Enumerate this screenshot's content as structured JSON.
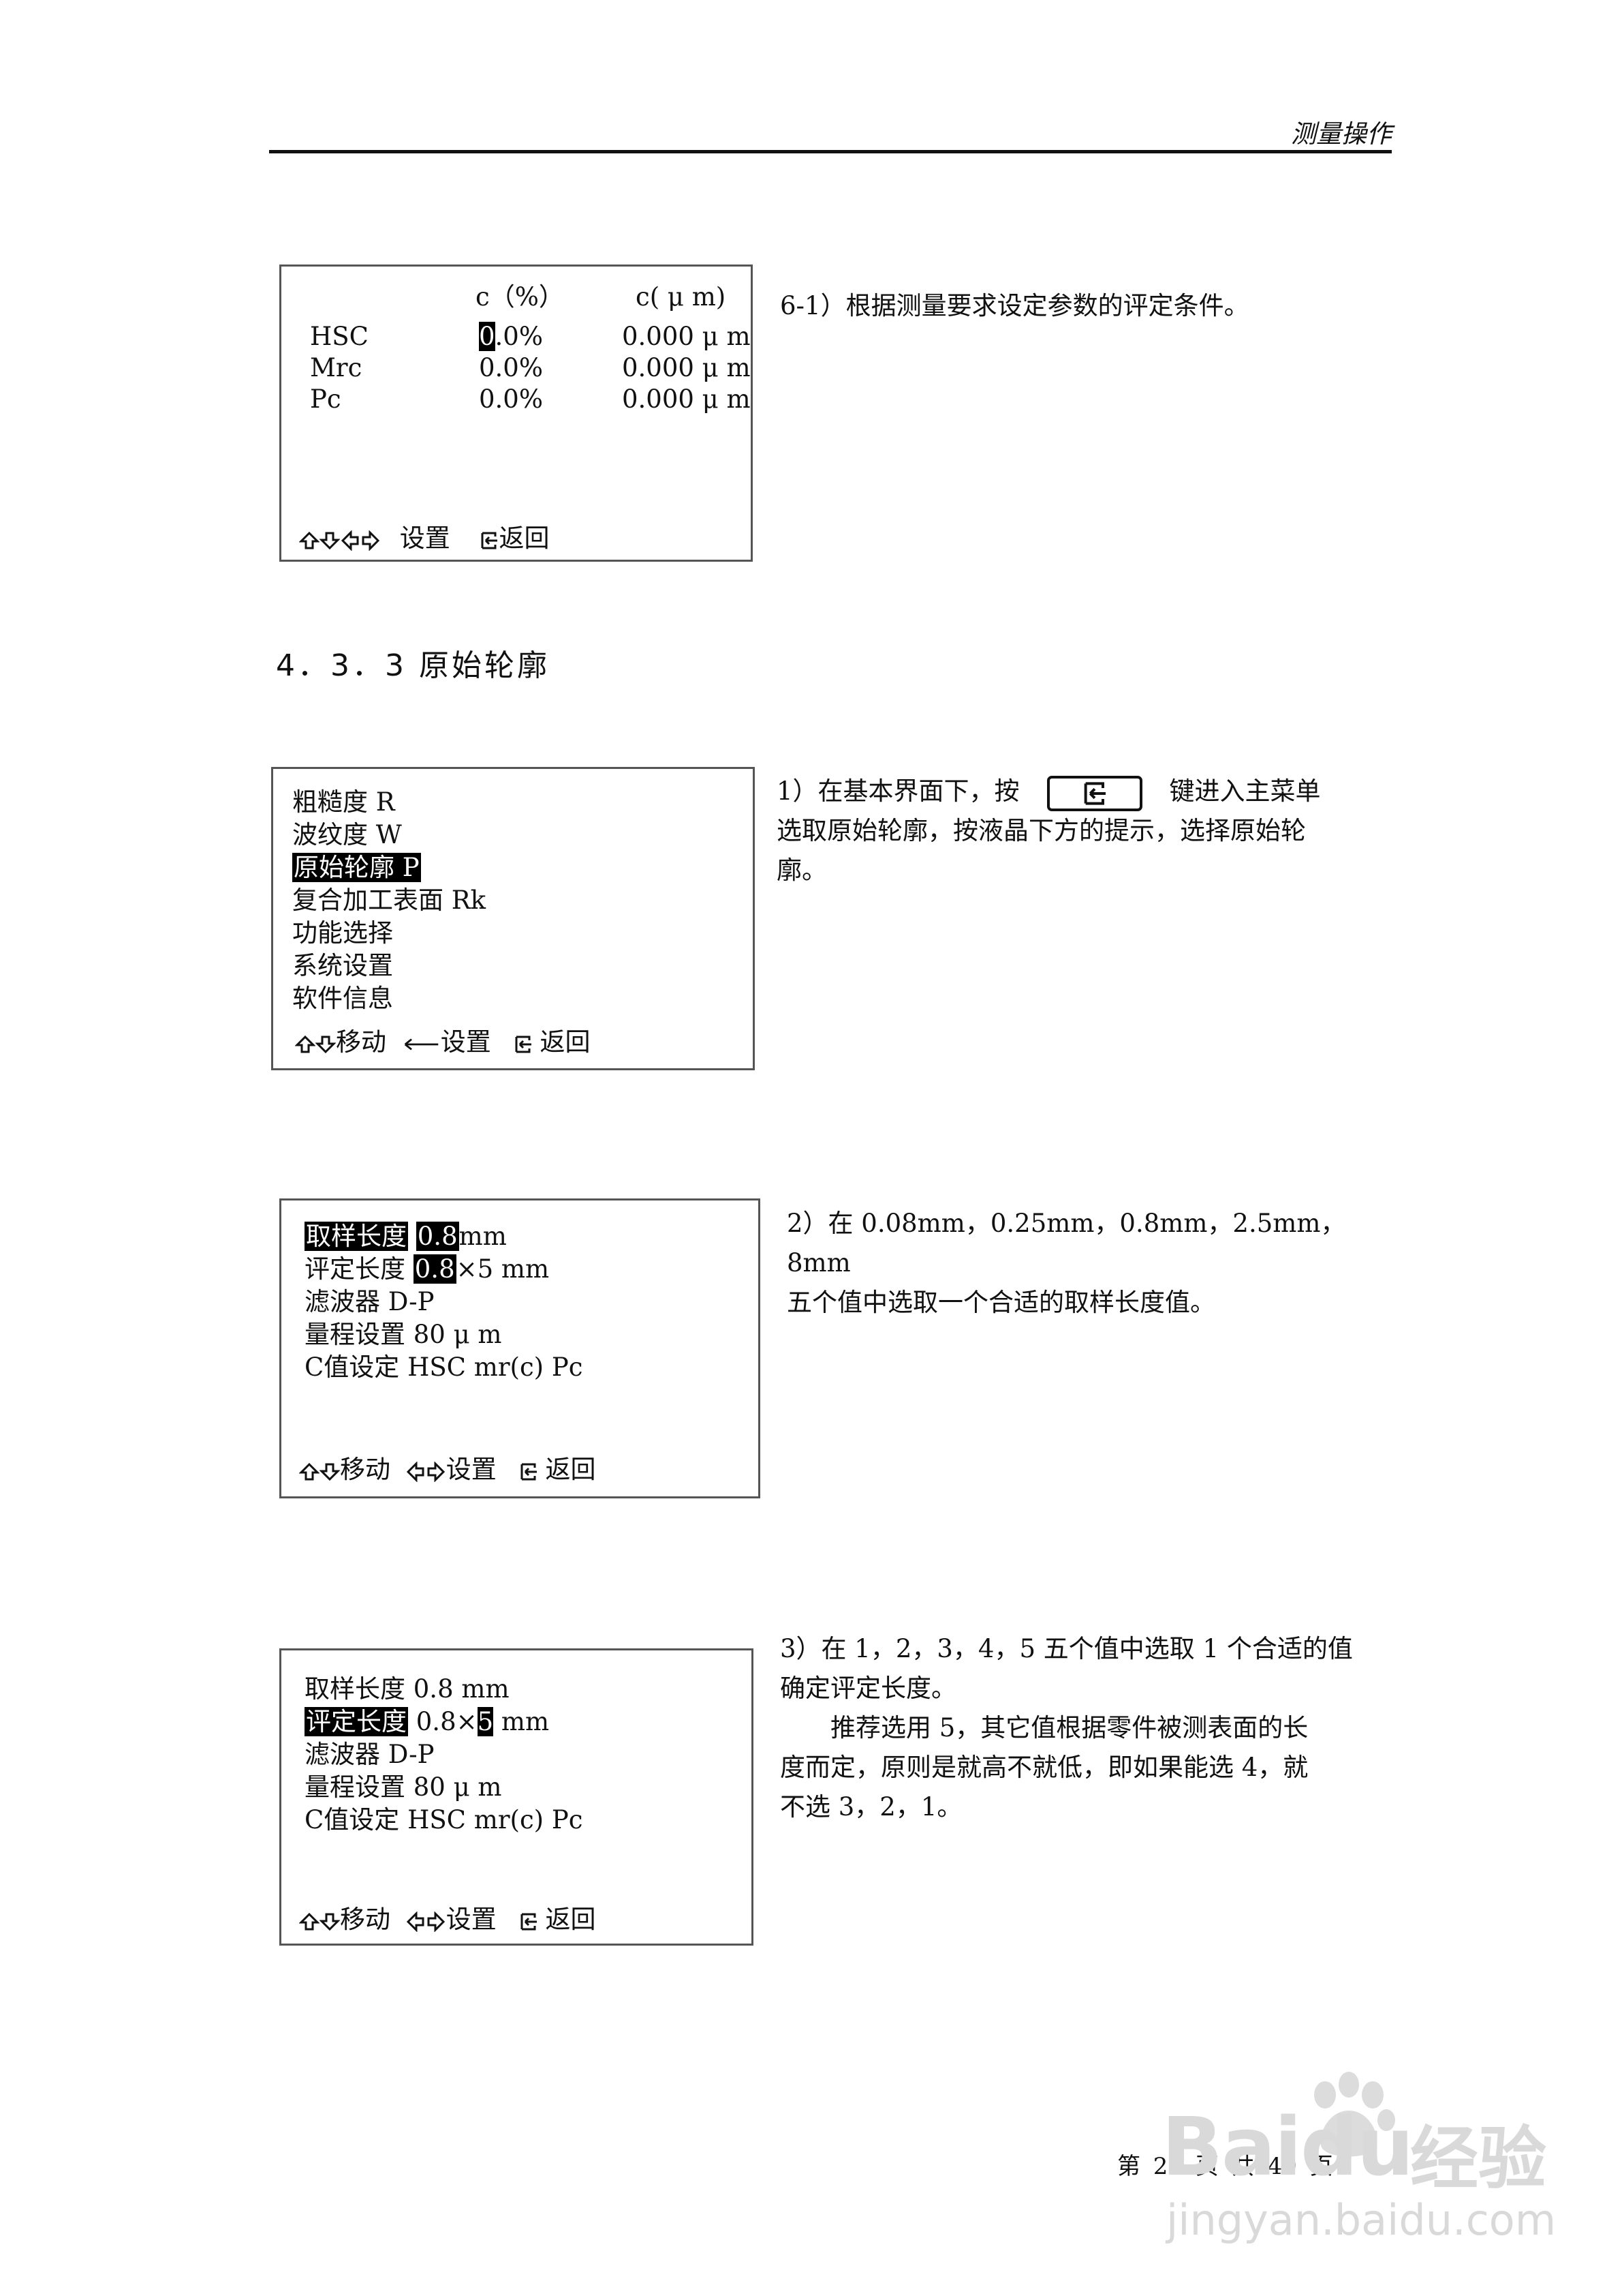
{
  "header": {
    "title": "测量操作"
  },
  "screen1": {
    "col1_header": "c（%）",
    "col2_header": "c( μ m)",
    "rows": [
      {
        "label": "HSC",
        "pct_cursor": "0",
        "pct_rest": ".0%",
        "um": "0.000 μ m"
      },
      {
        "label": "Mrc",
        "pct": "0.0%",
        "um": "0.000 μ m"
      },
      {
        "label": "Pc",
        "pct": "0.0%",
        "um": "0.000 μ m"
      }
    ],
    "footer_set": "设置",
    "footer_back": "返回"
  },
  "step6_1": "6-1）根据测量要求设定参数的评定条件。",
  "section_title": "4．3．3 原始轮廓",
  "screen2": {
    "menu": [
      "粗糙度 R",
      "波纹度 W",
      "原始轮廓 P",
      "复合加工表面 Rk",
      "功能选择",
      "系统设置",
      "软件信息"
    ],
    "footer_move": "移动",
    "footer_set": "设置",
    "footer_back": "返回"
  },
  "step1": {
    "before_key": "1）在基本界面下，按",
    "after_key": "键进入主菜单",
    "line2": "选取原始轮廓，按液晶下方的提示，选择原始轮",
    "line3": "廓。"
  },
  "screen3": {
    "row1_label": "取样长度",
    "row1_value": "0.8",
    "row1_unit": "mm",
    "row2_label": "评定长度",
    "row2_value": "0.8",
    "row2_rest": "×5  mm",
    "row3": "滤波器  D-P",
    "row4": "量程设置  80  μ m",
    "row5": "C值设定  HSC  mr(c)  Pc",
    "footer_move": "移动",
    "footer_set": "设置",
    "footer_back": "返回"
  },
  "step2": {
    "line1": "2）在 0.08mm，0.25mm，0.8mm，2.5mm，8mm",
    "line2": "五个值中选取一个合适的取样长度值。"
  },
  "screen4": {
    "row1": "取样长度  0.8 mm",
    "row2_label": "评定长度",
    "row2_value": " 0.8×",
    "row2_cursor": "5",
    "row2_unit": " mm",
    "row3": "滤波器  D-P",
    "row4": "量程设置  80  μ m",
    "row5": "C值设定  HSC  mr(c)  Pc",
    "footer_move": "移动",
    "footer_set": "设置",
    "footer_back": "返回"
  },
  "step3": {
    "line1": "3）在 1，2，3，4，5 五个值中选取 1 个合适的值",
    "line2": "确定评定长度。",
    "line3": "推荐选用 5，其它值根据零件被测表面的长",
    "line4": "度而定，原则是就高不就低，即如果能选 4，就",
    "line5": "不选 3，2，1。"
  },
  "footer": {
    "page_text": "第 22 页 共 49 页"
  },
  "watermark": {
    "brand_latin": "Baidu",
    "brand_cn": "经验",
    "url": "jingyan.baidu.com"
  }
}
